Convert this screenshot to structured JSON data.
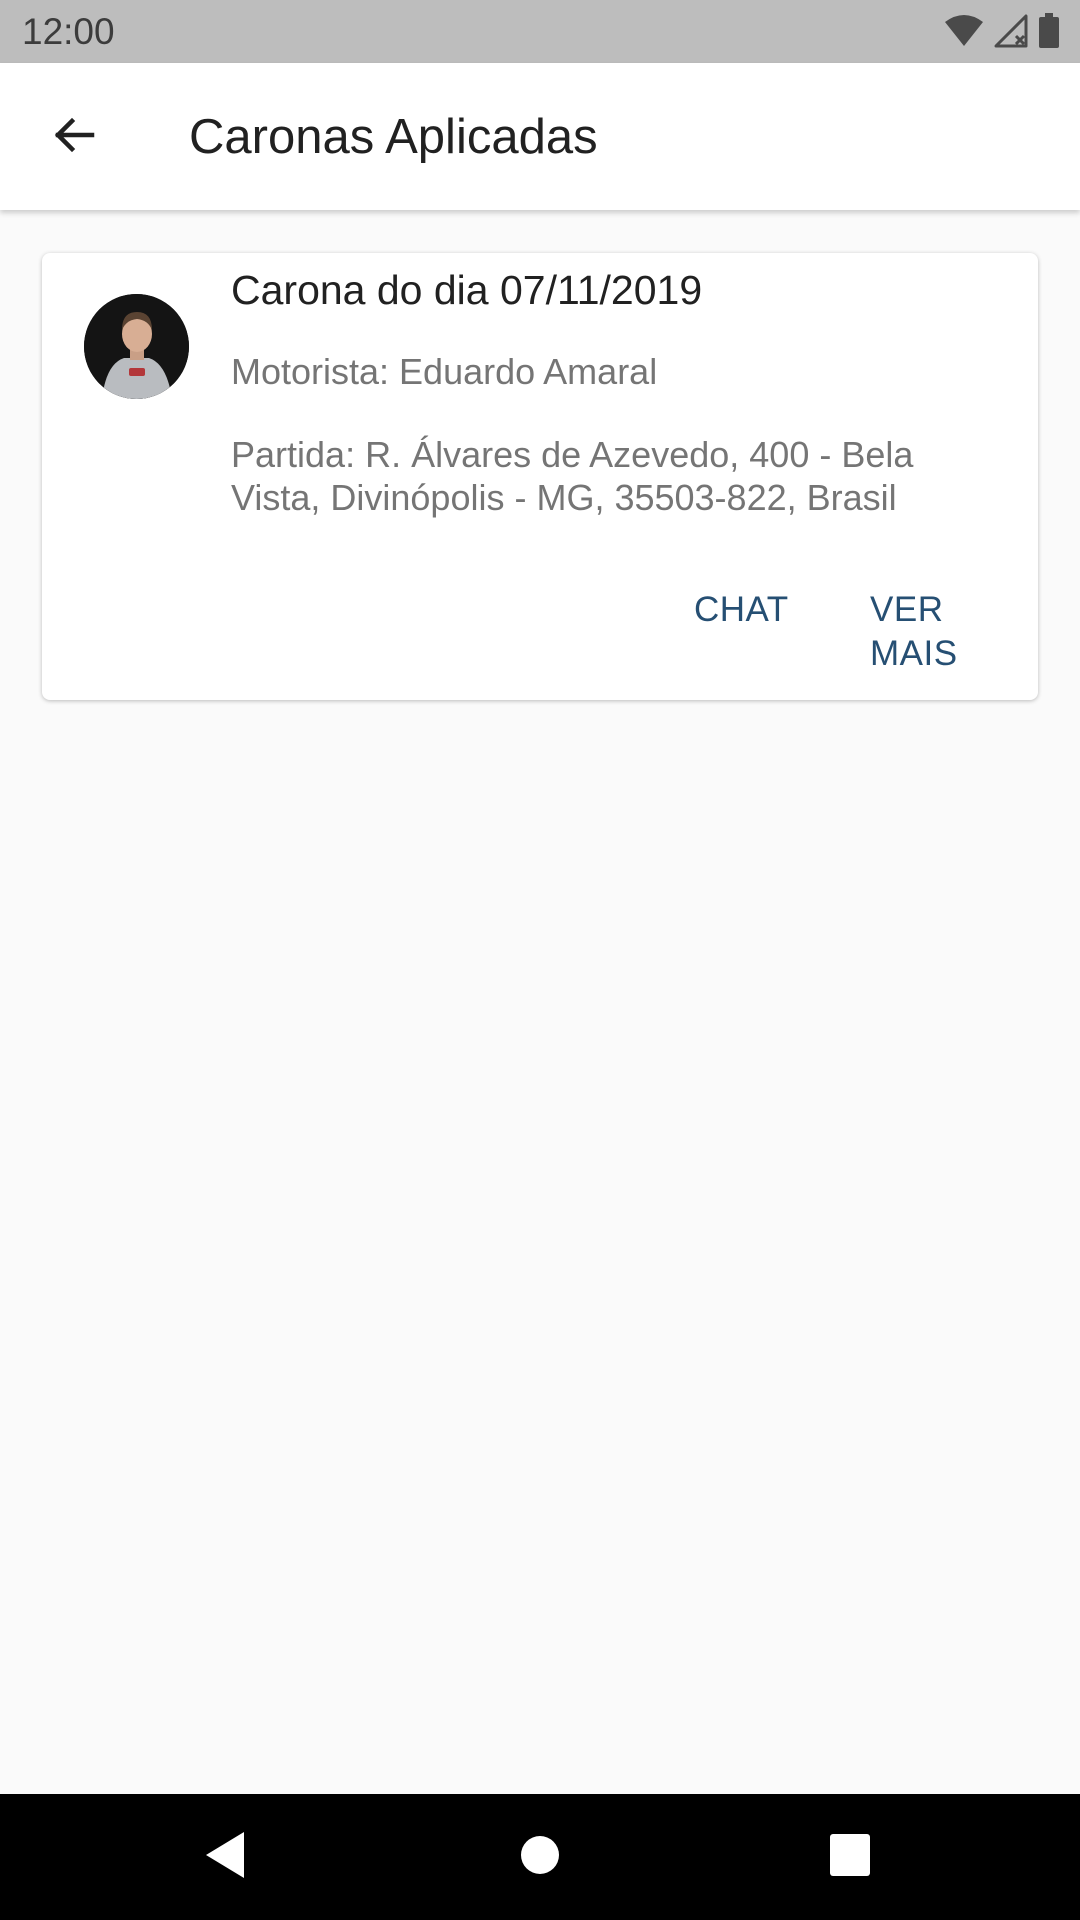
{
  "status_bar": {
    "time": "12:00",
    "icons": [
      "wifi-icon",
      "signal-icon",
      "battery-icon"
    ]
  },
  "app_bar": {
    "back_icon": "arrow-back-icon",
    "title": "Caronas Aplicadas",
    "background": "#ffffff"
  },
  "rides": [
    {
      "avatar": "driver-avatar",
      "title": "Carona do dia 07/11/2019",
      "driver": "Motorista: Eduardo Amaral",
      "departure": "Partida: R. Álvares de Azevedo, 400 - Bela Vista, Divinópolis - MG, 35503-822, Brasil",
      "actions": {
        "chat": "CHAT",
        "more": "VER MAIS"
      }
    }
  ],
  "nav_bar": {
    "icons": [
      "nav-back-icon",
      "nav-home-icon",
      "nav-recents-icon"
    ]
  },
  "colors": {
    "accent": "#264f73",
    "status_bar": "#bdbdbd",
    "background": "#fafafa",
    "nav_bar": "#000000"
  }
}
